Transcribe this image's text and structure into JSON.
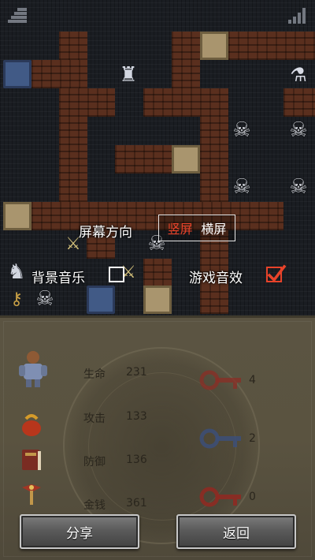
{
  "settings": {
    "orientation_label": "屏幕方向",
    "orientation_options": [
      "竖屏",
      "横屏"
    ],
    "orientation_selected": "竖屏",
    "music_label": "背景音乐",
    "music_enabled": false,
    "sfx_label": "游戏音效",
    "sfx_enabled": true
  },
  "stats": {
    "hp_label": "生命",
    "hp_value": "231",
    "attack_label": "攻击",
    "attack_value": "133",
    "defense_label": "防御",
    "defense_value": "136",
    "gold_label": "金钱",
    "gold_value": "361"
  },
  "keys": {
    "yellow": "4",
    "blue": "2",
    "red": "0"
  },
  "buttons": {
    "share": "分享",
    "back": "返回"
  },
  "colors": {
    "accent_red": "#e8432a",
    "wall": "#5a2f1e",
    "panel": "#5a5340",
    "button": "#5b5b5b"
  },
  "icons": {
    "top_left": "stairs-icon",
    "top_right": "signal-icon",
    "checkmark": "checkmark-icon"
  }
}
